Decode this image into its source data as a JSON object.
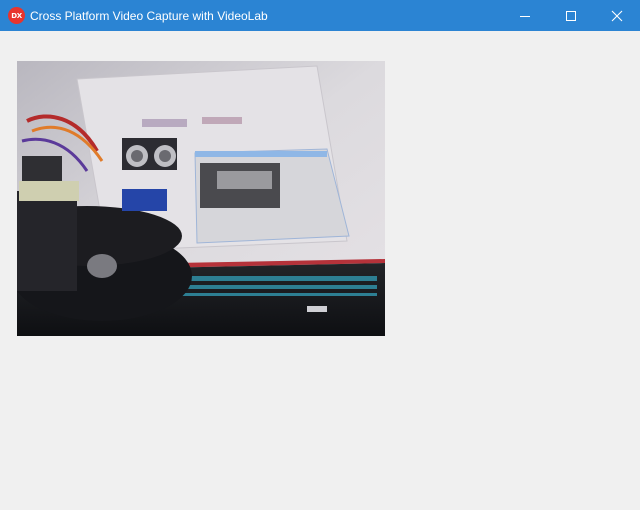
{
  "window": {
    "title": "Cross Platform Video Capture with VideoLab",
    "app_icon_text": "DX",
    "titlebar_color": "#2b84d3",
    "background_color": "#f0f0f0"
  },
  "controls": {
    "minimize_icon": "minimize-icon",
    "maximize_icon": "maximize-icon",
    "close_icon": "close-icon"
  },
  "video": {
    "content": "camera-feed"
  }
}
